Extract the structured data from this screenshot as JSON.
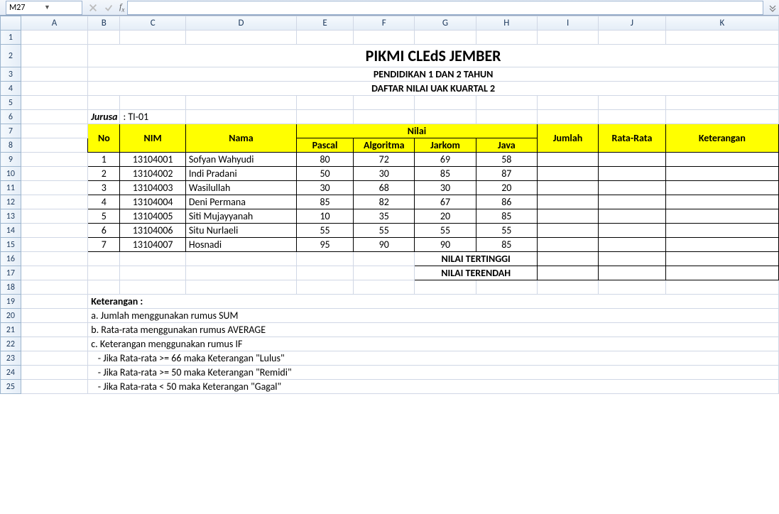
{
  "formula_bar": {
    "name_box": "M27",
    "formula": ""
  },
  "columns": [
    "A",
    "B",
    "C",
    "D",
    "E",
    "F",
    "G",
    "H",
    "I",
    "J",
    "K"
  ],
  "rows": [
    1,
    2,
    3,
    4,
    5,
    6,
    7,
    8,
    9,
    10,
    11,
    12,
    13,
    14,
    15,
    16,
    17,
    18,
    19,
    20,
    21,
    22,
    23,
    24,
    25
  ],
  "titles": {
    "main": "PIKMI CLEdS JEMBER",
    "sub1": "PENDIDIKAN 1 DAN 2 TAHUN",
    "sub2": "DAFTAR NILAI UAK KUARTAL 2"
  },
  "jurusan_label": "Jurusa",
  "jurusan_value": ": TI-01",
  "headers": {
    "no": "No",
    "nim": "NIM",
    "nama": "Nama",
    "nilai": "Nilai",
    "pascal": "Pascal",
    "algoritma": "Algoritma",
    "jarkom": "Jarkom",
    "java": "Java",
    "jumlah": "Jumlah",
    "rata": "Rata-Rata",
    "ket": "Keterangan"
  },
  "students": [
    {
      "no": "1",
      "nim": "13104001",
      "nama": "Sofyan Wahyudi",
      "pascal": "80",
      "algo": "72",
      "jarkom": "69",
      "java": "58"
    },
    {
      "no": "2",
      "nim": "13104002",
      "nama": "Indi Pradani",
      "pascal": "50",
      "algo": "30",
      "jarkom": "85",
      "java": "87"
    },
    {
      "no": "3",
      "nim": "13104003",
      "nama": "Wasilullah",
      "pascal": "30",
      "algo": "68",
      "jarkom": "30",
      "java": "20"
    },
    {
      "no": "4",
      "nim": "13104004",
      "nama": "Deni Permana",
      "pascal": "85",
      "algo": "82",
      "jarkom": "67",
      "java": "86"
    },
    {
      "no": "5",
      "nim": "13104005",
      "nama": "Siti Mujayyanah",
      "pascal": "10",
      "algo": "35",
      "jarkom": "20",
      "java": "85"
    },
    {
      "no": "6",
      "nim": "13104006",
      "nama": "Situ Nurlaeli",
      "pascal": "55",
      "algo": "55",
      "jarkom": "55",
      "java": "55"
    },
    {
      "no": "7",
      "nim": "13104007",
      "nama": "Hosnadi",
      "pascal": "95",
      "algo": "90",
      "jarkom": "90",
      "java": "85"
    }
  ],
  "summary": {
    "tertinggi": "NILAI TERTINGGI",
    "terendah": "NILAI TERENDAH"
  },
  "notes": {
    "heading": "Keterangan :",
    "a": "a. Jumlah menggunakan rumus SUM",
    "b": "b. Rata-rata menggunakan rumus AVERAGE",
    "c": "c. Keterangan menggunakan rumus IF",
    "c1": "   - Jika Rata-rata >= 66 maka Keterangan \"Lulus\"",
    "c2": "   - Jika Rata-rata >= 50 maka Keterangan \"Remidi\"",
    "c3": "   - Jika Rata-rata < 50 maka Keterangan \"Gagal\""
  }
}
